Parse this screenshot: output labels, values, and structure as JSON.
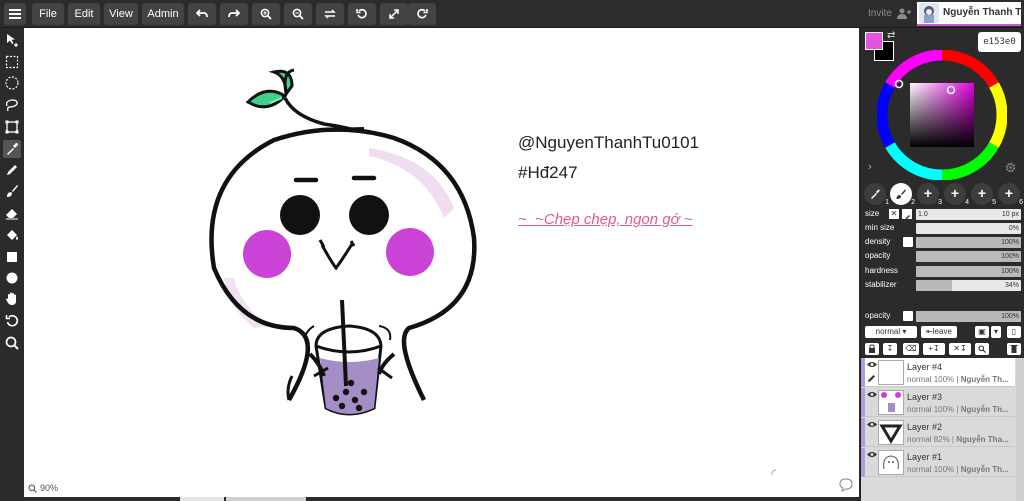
{
  "menu": {
    "file": "File",
    "edit": "Edit",
    "view": "View",
    "admin": "Admin"
  },
  "header": {
    "invite": "Invite",
    "user_name": "Nguyễn Thanh Tú"
  },
  "canvas": {
    "caption_handle": "@NguyenThanhTu0101",
    "caption_tag": "#Hđ247",
    "caption_quote": "~_~Chẹp chẹp, ngon gớ ~",
    "zoom": "90%"
  },
  "color": {
    "primary": "#e153e0",
    "secondary": "#000000",
    "hex": "e153e0"
  },
  "brushes": {
    "slots": [
      "1",
      "2",
      "3",
      "4",
      "5",
      "6"
    ]
  },
  "brush_settings": {
    "size_label": "size",
    "size_small": "1.0",
    "size_value": "10 px",
    "min_size_label": "min size",
    "min_size_value": "0%",
    "density_label": "density",
    "density_value": "100%",
    "opacity_label": "opacity",
    "opacity_value": "100%",
    "hardness_label": "hardness",
    "hardness_value": "100%",
    "stabilizer_label": "stabilizer",
    "stabilizer_value": "34%",
    "stabilizer_fraction": 0.34
  },
  "layer_settings": {
    "opacity_label": "opacity",
    "opacity_value": "100%",
    "blend_mode": "normal",
    "leave_label": "leave"
  },
  "layers": [
    {
      "name": "Layer #4",
      "mode": "normal",
      "opacity": "100%",
      "owner": "Nguyễn Th..."
    },
    {
      "name": "Layer #3",
      "mode": "normal",
      "opacity": "100%",
      "owner": "Nguyễn Th..."
    },
    {
      "name": "Layer #2",
      "mode": "normal",
      "opacity": "82%",
      "owner": "Nguyễn Tha..."
    },
    {
      "name": "Layer #1",
      "mode": "normal",
      "opacity": "100%",
      "owner": "Nguyễn Th..."
    }
  ]
}
